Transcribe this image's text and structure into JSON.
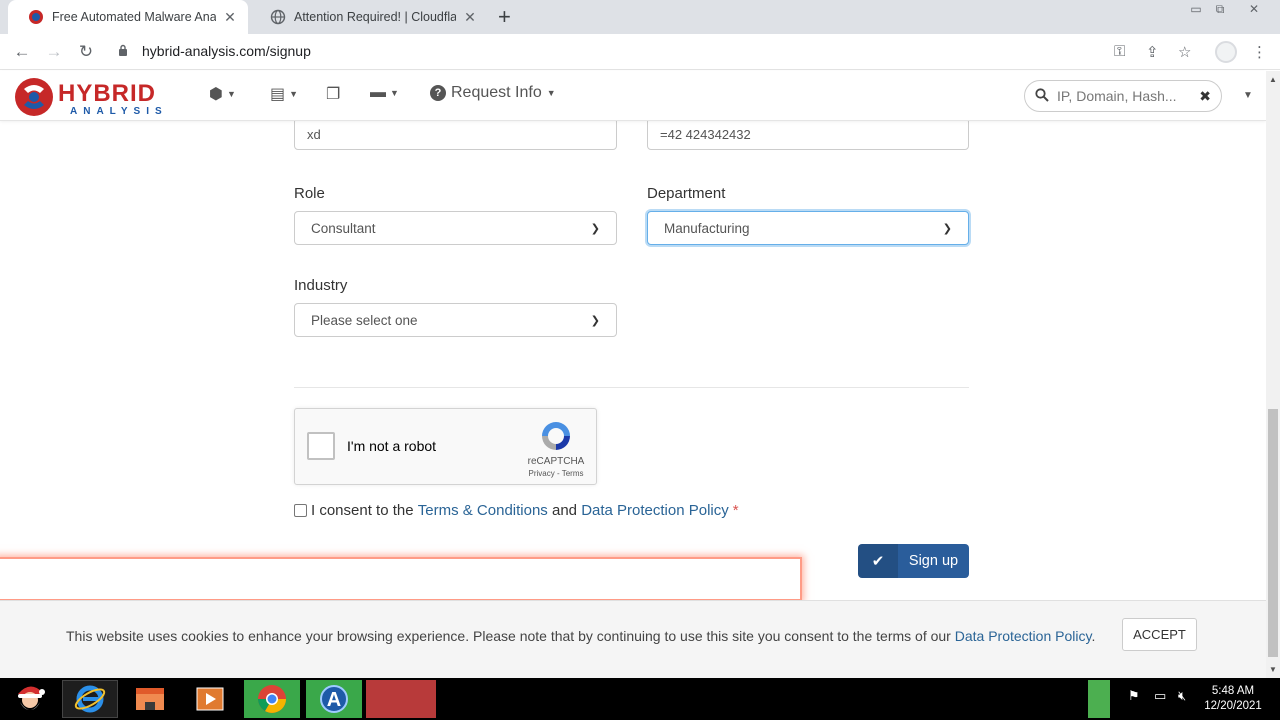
{
  "browser": {
    "tabs": [
      {
        "title": "Free Automated Malware Analysis",
        "active": true
      },
      {
        "title": "Attention Required! | Cloudflare",
        "active": false
      }
    ],
    "url": "hybrid-analysis.com/signup"
  },
  "header": {
    "logo_main": "HYBRID",
    "logo_sub": "ANALYSIS",
    "request_info": "Request Info",
    "search_placeholder": "IP, Domain, Hash..."
  },
  "form": {
    "field_left_value": "xd",
    "field_right_value": "=42 424342432",
    "role_label": "Role",
    "role_value": "Consultant",
    "department_label": "Department",
    "department_value": "Manufacturing",
    "industry_label": "Industry",
    "industry_value": "Please select one"
  },
  "recaptcha": {
    "label": "I'm not a robot",
    "brand": "reCAPTCHA",
    "links": "Privacy - Terms"
  },
  "consent": {
    "prefix": "I consent to the",
    "terms_link": "Terms & Conditions",
    "and_text": "and",
    "policy_link": "Data Protection Policy",
    "required_mark": "*"
  },
  "signup_button": "Sign up",
  "cookie": {
    "message": "This website uses cookies to enhance your browsing experience. Please note that by continuing to use this site you consent to the terms of our",
    "link": "Data Protection Policy",
    "period": ".",
    "accept": "ACCEPT"
  },
  "taskbar": {
    "time": "5:48 AM",
    "date": "12/20/2021"
  }
}
